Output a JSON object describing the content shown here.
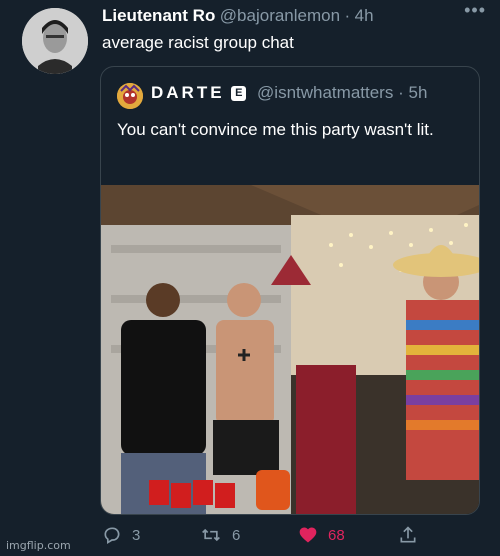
{
  "tweet": {
    "display_name": "Lieutenant Ro",
    "handle": "@bajoranlemon",
    "separator": "·",
    "time": "4h",
    "text": "average racist group chat",
    "more_label": "•••"
  },
  "quoted": {
    "name": "DARTE",
    "badge": "E",
    "handle": "@isntwhatmatters",
    "separator": "·",
    "time": "5h",
    "text": "You can't convince me this party wasn't lit."
  },
  "actions": {
    "reply_count": "3",
    "retweet_count": "6",
    "like_count": "68"
  },
  "icons": {
    "reply": "reply-icon",
    "retweet": "retweet-icon",
    "like": "heart-icon",
    "share": "share-icon",
    "more": "more-icon"
  },
  "colors": {
    "background": "#15202b",
    "muted": "#8899a6",
    "like": "#e0245e",
    "border": "#38444d"
  },
  "watermark": "imgflip.com"
}
